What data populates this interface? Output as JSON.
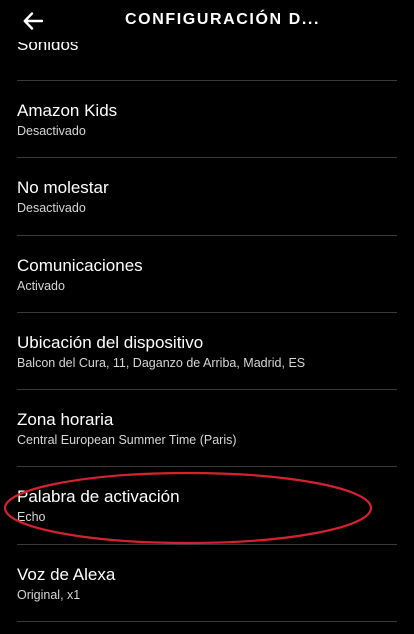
{
  "header": {
    "title": "CONFIGURACIÓN D...",
    "back_icon": "arrow-left-icon"
  },
  "settings": [
    {
      "title": "Sonidos",
      "subtitle": ""
    },
    {
      "title": "Amazon Kids",
      "subtitle": "Desactivado"
    },
    {
      "title": "No molestar",
      "subtitle": "Desactivado"
    },
    {
      "title": "Comunicaciones",
      "subtitle": "Activado"
    },
    {
      "title": "Ubicación del dispositivo",
      "subtitle": "Balcon del Cura, 11, Daganzo de Arriba, Madrid, ES"
    },
    {
      "title": "Zona horaria",
      "subtitle": "Central European Summer Time (Paris)"
    },
    {
      "title": "Palabra de activación",
      "subtitle": "Echo"
    },
    {
      "title": "Voz de Alexa",
      "subtitle": "Original, x1"
    }
  ],
  "colors": {
    "background": "#000000",
    "text": "#ffffff",
    "subtext": "#d6d6d6",
    "divider": "#3a3a3a",
    "annotation": "#d4232f"
  }
}
